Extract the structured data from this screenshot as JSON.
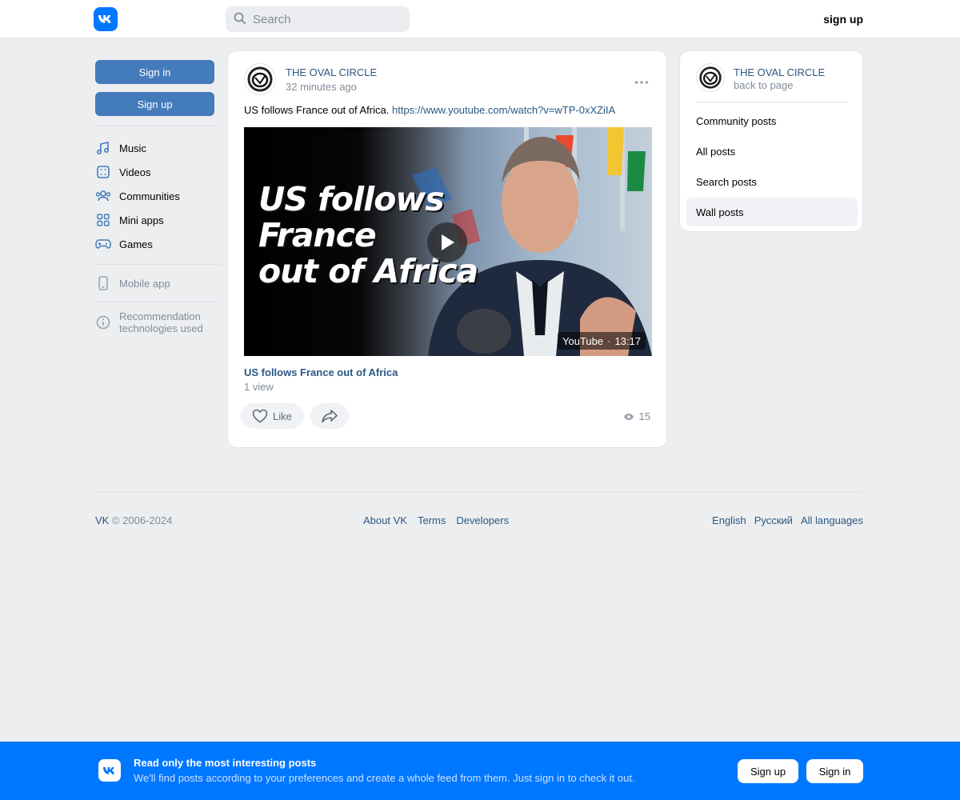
{
  "header": {
    "logo_icon": "vk-logo-icon",
    "search_placeholder": "Search",
    "signup_label": "sign up"
  },
  "left": {
    "sign_in": "Sign in",
    "sign_up": "Sign up",
    "nav": [
      {
        "label": "Music",
        "icon": "music-note-icon"
      },
      {
        "label": "Videos",
        "icon": "videos-icon"
      },
      {
        "label": "Communities",
        "icon": "communities-icon"
      },
      {
        "label": "Mini apps",
        "icon": "mini-apps-icon"
      },
      {
        "label": "Games",
        "icon": "gamepad-icon"
      }
    ],
    "mobile_app": "Mobile app",
    "recommendation": "Recommendation technologies used"
  },
  "post": {
    "author": "THE OVAL CIRCLE",
    "time": "32 minutes ago",
    "text": "US follows France out of Africa.",
    "link": "https://www.youtube.com/watch?v=wTP-0xXZiIA",
    "video": {
      "overlay_line1": "US follows",
      "overlay_line2": "France",
      "overlay_line3": "out of Africa",
      "source": "YouTube",
      "duration": "13:17",
      "title": "US follows France out of Africa",
      "views": "1 view"
    },
    "like_label": "Like",
    "view_count": "15"
  },
  "side": {
    "name": "THE OVAL CIRCLE",
    "back": "back to page",
    "items": [
      "Community posts",
      "All posts",
      "Search posts",
      "Wall posts"
    ],
    "active": "Wall posts"
  },
  "footer": {
    "brand": "VK",
    "copyright": "© 2006-2024",
    "links": [
      "About VK",
      "Terms",
      "Developers"
    ],
    "languages": [
      "English",
      "Русский",
      "All languages"
    ]
  },
  "banner": {
    "title": "Read only the most interesting posts",
    "subtitle": "We'll find posts according to your preferences and create a whole feed from them. Just sign in to check it out.",
    "sign_up": "Sign up",
    "sign_in": "Sign in"
  },
  "colors": {
    "brand_blue": "#0077ff",
    "button_blue": "#447bba",
    "link": "#2a5885",
    "page_bg": "#edeef0"
  }
}
